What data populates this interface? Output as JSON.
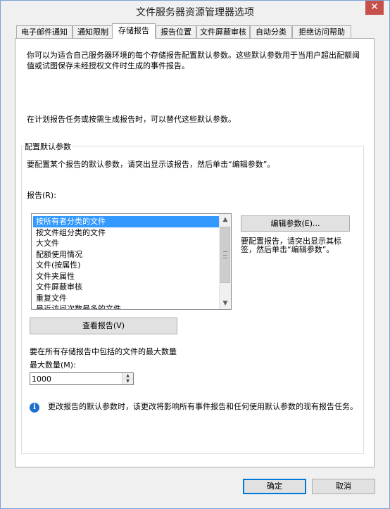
{
  "window": {
    "title": "文件服务器资源管理器选项",
    "close_label": "✕"
  },
  "tabs": [
    {
      "label": "电子邮件通知",
      "active": false
    },
    {
      "label": "通知限制",
      "active": false
    },
    {
      "label": "存储报告",
      "active": true
    },
    {
      "label": "报告位置",
      "active": false
    },
    {
      "label": "文件屏蔽审核",
      "active": false
    },
    {
      "label": "自动分类",
      "active": false
    },
    {
      "label": "拒绝访问帮助",
      "active": false
    }
  ],
  "storage_reports": {
    "intro": "你可以为适合自己服务器环境的每个存储报告配置默认参数。这些默认参数用于当用户超出配额阈值或试图保存未经授权文件时生成的事件报告。",
    "override_note": "在计划报告任务或按需生成报告时，可以替代这些默认参数。",
    "group_title": "配置默认参数",
    "group_desc": "要配置某个报告的默认参数，请突出显示该报告，然后单击“编辑参数”。",
    "reports_label": "报告(R):",
    "reports": [
      "按所有者分类的文件",
      "按文件组分类的文件",
      "大文件",
      "配额使用情况",
      "文件(按属性)",
      "文件夹属性",
      "文件屏蔽审核",
      "重复文件",
      "最近访问次数最多的文件"
    ],
    "selected_report": "按所有者分类的文件",
    "edit_button": "编辑参数(E)...",
    "edit_hint": "要配置报告，请突出显示其标签，然后单击“编辑参数”。",
    "view_button": "查看报告(V)",
    "max_desc": "要在所有存储报告中包括的文件的最大数量",
    "max_label": "最大数量(M):",
    "max_value": "1000",
    "info_text": "更改报告的默认参数时，该更改将影响所有事件报告和任何使用默认参数的现有报告任务。"
  },
  "footer": {
    "ok": "确定",
    "cancel": "取消"
  },
  "icons": {
    "info": "info-icon",
    "close": "close-icon"
  },
  "colors": {
    "selection": "#3399ff",
    "primary_border": "#0078d7",
    "close": "#c7504a"
  }
}
